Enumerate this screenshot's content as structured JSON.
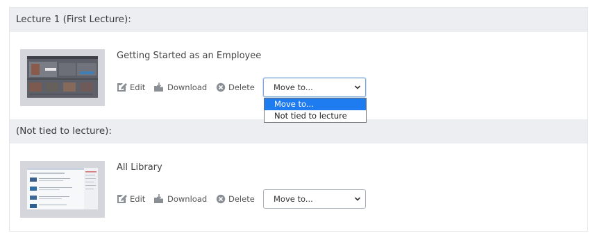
{
  "colors": {
    "header_bg": "#eceef2",
    "selected_option": "#1e7bf0",
    "text": "#333333"
  },
  "sections": [
    {
      "header": "Lecture 1 (First Lecture):",
      "item": {
        "title": "Getting Started as an Employee",
        "thumbnail": "video-thumbnail",
        "actions": {
          "edit": "Edit",
          "download": "Download",
          "delete": "Delete"
        },
        "move_select": {
          "value": "Move to...",
          "open": true
        }
      }
    },
    {
      "header": "(Not tied to lecture):",
      "item": {
        "title": "All Library",
        "thumbnail": "library-page-thumbnail",
        "actions": {
          "edit": "Edit",
          "download": "Download",
          "delete": "Delete"
        },
        "move_select": {
          "value": "Move to...",
          "open": false
        }
      }
    }
  ],
  "move_options": [
    {
      "label": "Move to...",
      "selected": true
    },
    {
      "label": "Not tied to lecture",
      "selected": false
    }
  ],
  "icons": {
    "edit": "edit-icon",
    "download": "download-icon",
    "delete": "delete-icon",
    "select_arrow": "chevron-down-icon"
  }
}
